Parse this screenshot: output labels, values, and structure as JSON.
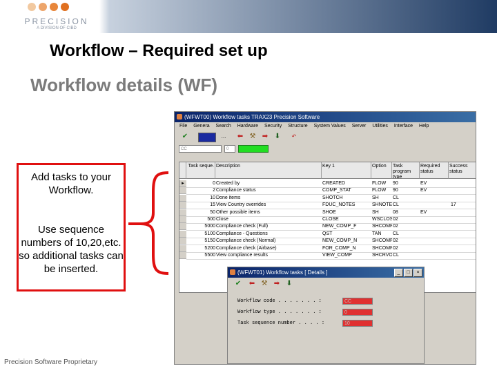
{
  "logo": {
    "name": "PRECISION",
    "tagline": "A DIVISION OF CIBD",
    "dot_colors": [
      "#f2c9a0",
      "#eda56b",
      "#e8863a",
      "#e07020"
    ]
  },
  "heading": "Workflow – Required set up",
  "subheading": "Workflow details (WF)",
  "callout": {
    "text1": "Add tasks to your Workflow.",
    "text2": "Use sequence numbers of 10,20,etc. so additional tasks can be inserted."
  },
  "footer": "Precision Software Proprietary",
  "main_window": {
    "title": "(WFWT00) Workflow tasks    TRAX23  Precision Software",
    "menu": [
      "File",
      "Genera",
      "Search",
      "Hardware",
      "Security",
      "Structure",
      "System Values",
      "Server",
      "Utilities",
      "Interface",
      "Help"
    ],
    "field1": "CC",
    "field2": "0",
    "columns": [
      "Task seque.",
      "Description",
      "Key 1",
      "Option",
      "Task program type",
      "Required status",
      "Success status"
    ],
    "rows": [
      [
        "0",
        "Created by",
        "CREATED",
        "FLOW",
        "90",
        "EV",
        ""
      ],
      [
        "2",
        "Compliance status",
        "COMP_STAT",
        "FLOW",
        "90",
        "EV",
        ""
      ],
      [
        "10",
        "Done items",
        "SHOTCH",
        "SH",
        "CL",
        "",
        ""
      ],
      [
        "15",
        "View Country overrides",
        "FDUC_NOTES",
        "SHNOTE",
        "CL",
        "",
        ""
      ],
      [
        "50",
        "Other possible items",
        "SHOE",
        "SH",
        "08",
        "EV",
        ""
      ],
      [
        "500",
        "Close",
        "CLOSE",
        "WSCLOS",
        "02",
        "",
        ""
      ],
      [
        "5000",
        "Compliance check (Full)",
        "NEW_COMP_F",
        "SHCOMP",
        "02",
        "",
        ""
      ],
      [
        "5100",
        "Compliance - Questions",
        "QST",
        "TAN",
        "CL",
        "",
        ""
      ],
      [
        "5150",
        "Compliance check (Normal)",
        "NEW_COMP_N",
        "SHCOMP",
        "02",
        "",
        ""
      ],
      [
        "5200",
        "Compliance check (Airbase)",
        "FOR_COMP_N",
        "SHCOMP",
        "02",
        "",
        ""
      ],
      [
        "5500",
        "View compliance results",
        "VIEW_COMP",
        "SHCRVO",
        "CL",
        "",
        ""
      ]
    ],
    "extra_value": "17"
  },
  "dialog": {
    "title": "(WFWT01) Workflow tasks [ Details ]",
    "fields": [
      {
        "label": "Workflow code  . . . . . . . :",
        "value": "CC"
      },
      {
        "label": "Workflow type  . . . . . . . :",
        "value": "0"
      },
      {
        "label": "Task sequence number . . . . :",
        "value": "10"
      }
    ]
  }
}
